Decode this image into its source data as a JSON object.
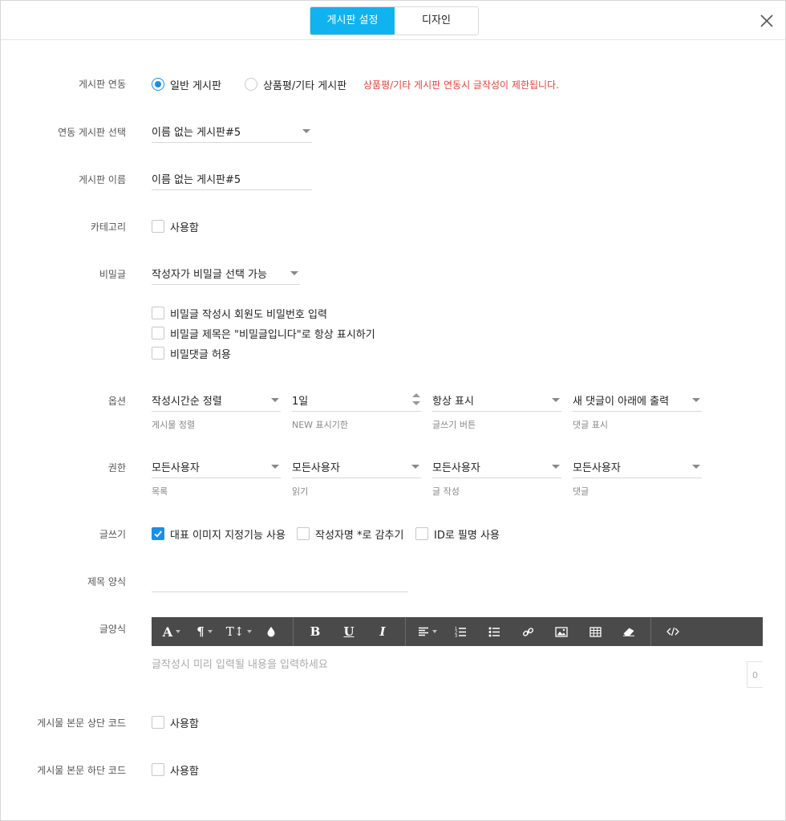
{
  "header": {
    "tabs": [
      {
        "label": "게시판 설정",
        "active": true
      },
      {
        "label": "디자인",
        "active": false
      }
    ]
  },
  "colors": {
    "accent": "#10b3f0",
    "checkbox": "#1a8fe8",
    "warning": "#e8413a",
    "toolbar": "#4a4a4a"
  },
  "form": {
    "link": {
      "label": "게시판 연동",
      "options": [
        "일반 게시판",
        "상품평/기타 게시판"
      ],
      "selected": "일반 게시판",
      "warning": "상품평/기타 게시판 연동시 글작성이 제한됩니다."
    },
    "select_board": {
      "label": "연동 게시판 선택",
      "value": "이름 없는 게시판#5"
    },
    "board_name": {
      "label": "게시판 이름",
      "value": "이름 없는 게시판#5"
    },
    "category": {
      "label": "카테고리",
      "checkbox": "사용함",
      "checked": false
    },
    "secret": {
      "label": "비밀글",
      "value": "작성자가 비밀글 선택 가능",
      "checks": [
        {
          "label": "비밀글 작성시 회원도 비밀번호 입력",
          "checked": false
        },
        {
          "label": "비밀글 제목은 \"비밀글입니다\"로 항상 표시하기",
          "checked": false
        },
        {
          "label": "비밀댓글 허용",
          "checked": false
        }
      ]
    },
    "options": {
      "label": "옵션",
      "fields": [
        {
          "value": "작성시간순 정렬",
          "sub": "게시물 정렬"
        },
        {
          "value": "1일",
          "sub": "NEW 표시기한"
        },
        {
          "value": "항상 표시",
          "sub": "글쓰기 버튼"
        },
        {
          "value": "새 댓글이 아래에 출력",
          "sub": "댓글 표시"
        }
      ]
    },
    "permissions": {
      "label": "권한",
      "fields": [
        {
          "value": "모든사용자",
          "sub": "목록"
        },
        {
          "value": "모든사용자",
          "sub": "읽기"
        },
        {
          "value": "모든사용자",
          "sub": "글 작성"
        },
        {
          "value": "모든사용자",
          "sub": "댓글"
        }
      ]
    },
    "writing": {
      "label": "글쓰기",
      "checks": [
        {
          "label": "대표 이미지 지정기능 사용",
          "checked": true
        },
        {
          "label": "작성자명 *로 감추기",
          "checked": false
        },
        {
          "label": "ID로 필명 사용",
          "checked": false
        }
      ]
    },
    "title_format": {
      "label": "제목 양식",
      "value": ""
    },
    "body_format": {
      "label": "글양식",
      "placeholder": "글작성시 미리 입력될 내용을 입력하세요",
      "counter": "0",
      "toolbar": [
        "font-color",
        "paragraph",
        "text-size",
        "color-fill",
        "bold",
        "underline",
        "italic",
        "align",
        "ordered-list",
        "bullet-list",
        "link",
        "image",
        "table",
        "eraser",
        "code-view"
      ]
    },
    "top_code": {
      "label": "게시물 본문 상단 코드",
      "checkbox": "사용함",
      "checked": false
    },
    "bottom_code": {
      "label": "게시물 본문 하단 코드",
      "checkbox": "사용함",
      "checked": false
    }
  }
}
